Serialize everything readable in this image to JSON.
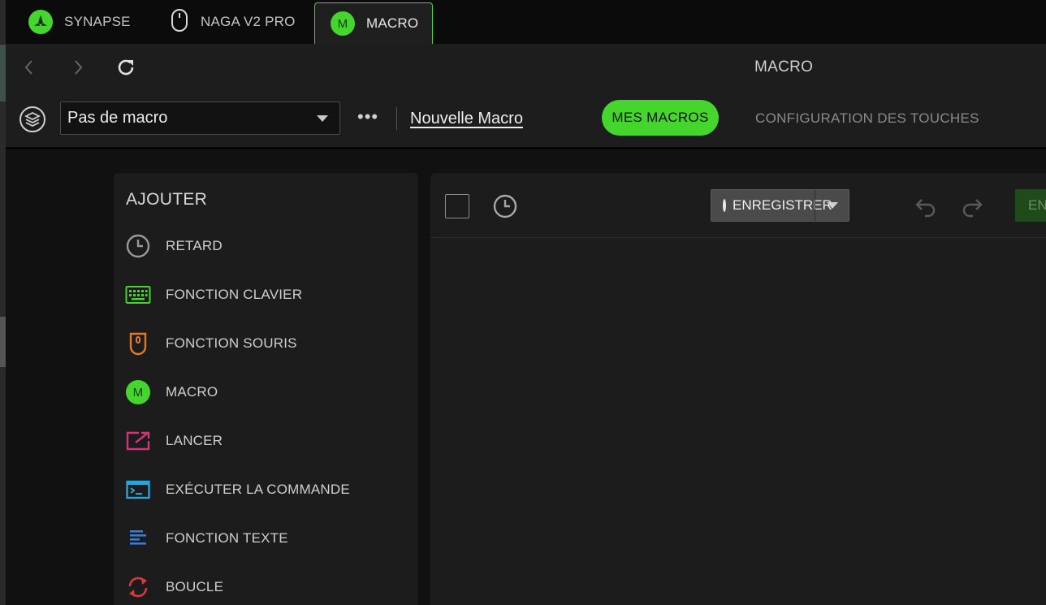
{
  "tabs": [
    {
      "label": "SYNAPSE",
      "icon": "razer-logo-icon"
    },
    {
      "label": "NAGA V2 PRO",
      "icon": "mouse-icon"
    },
    {
      "label": "MACRO",
      "icon": "macro-badge-icon",
      "badge": "M",
      "active": true
    }
  ],
  "header": {
    "title": "MACRO",
    "macro_select": {
      "value": "Pas de macro"
    },
    "more_label": "•••",
    "new_macro_label": "Nouvelle Macro",
    "nav_tabs": [
      {
        "label": "MES MACROS",
        "active": true
      },
      {
        "label": "CONFIGURATION DES TOUCHES",
        "active": false
      }
    ]
  },
  "add_panel": {
    "title": "AJOUTER",
    "items": [
      {
        "label": "RETARD",
        "icon": "clock-icon",
        "color": "#9a9a9a"
      },
      {
        "label": "FONCTION CLAVIER",
        "icon": "keyboard-icon",
        "color": "#44d62c"
      },
      {
        "label": "FONCTION SOURIS",
        "icon": "mouse-icon",
        "color": "#e07b24"
      },
      {
        "label": "MACRO",
        "icon": "macro-badge-icon",
        "badge": "M",
        "color": "#44d62c"
      },
      {
        "label": "LANCER",
        "icon": "launch-icon",
        "color": "#d6337d"
      },
      {
        "label": "EXÉCUTER LA COMMANDE",
        "icon": "terminal-icon",
        "color": "#2ba4d8"
      },
      {
        "label": "FONCTION TEXTE",
        "icon": "text-icon",
        "color": "#3a7bd5"
      },
      {
        "label": "BOUCLE",
        "icon": "loop-icon",
        "color": "#d63a3a"
      }
    ]
  },
  "editor": {
    "record_label": "ENREGISTRER",
    "save_label": "ENREGISTRER"
  },
  "colors": {
    "accent": "#44d62c",
    "record": "#d8253a"
  }
}
